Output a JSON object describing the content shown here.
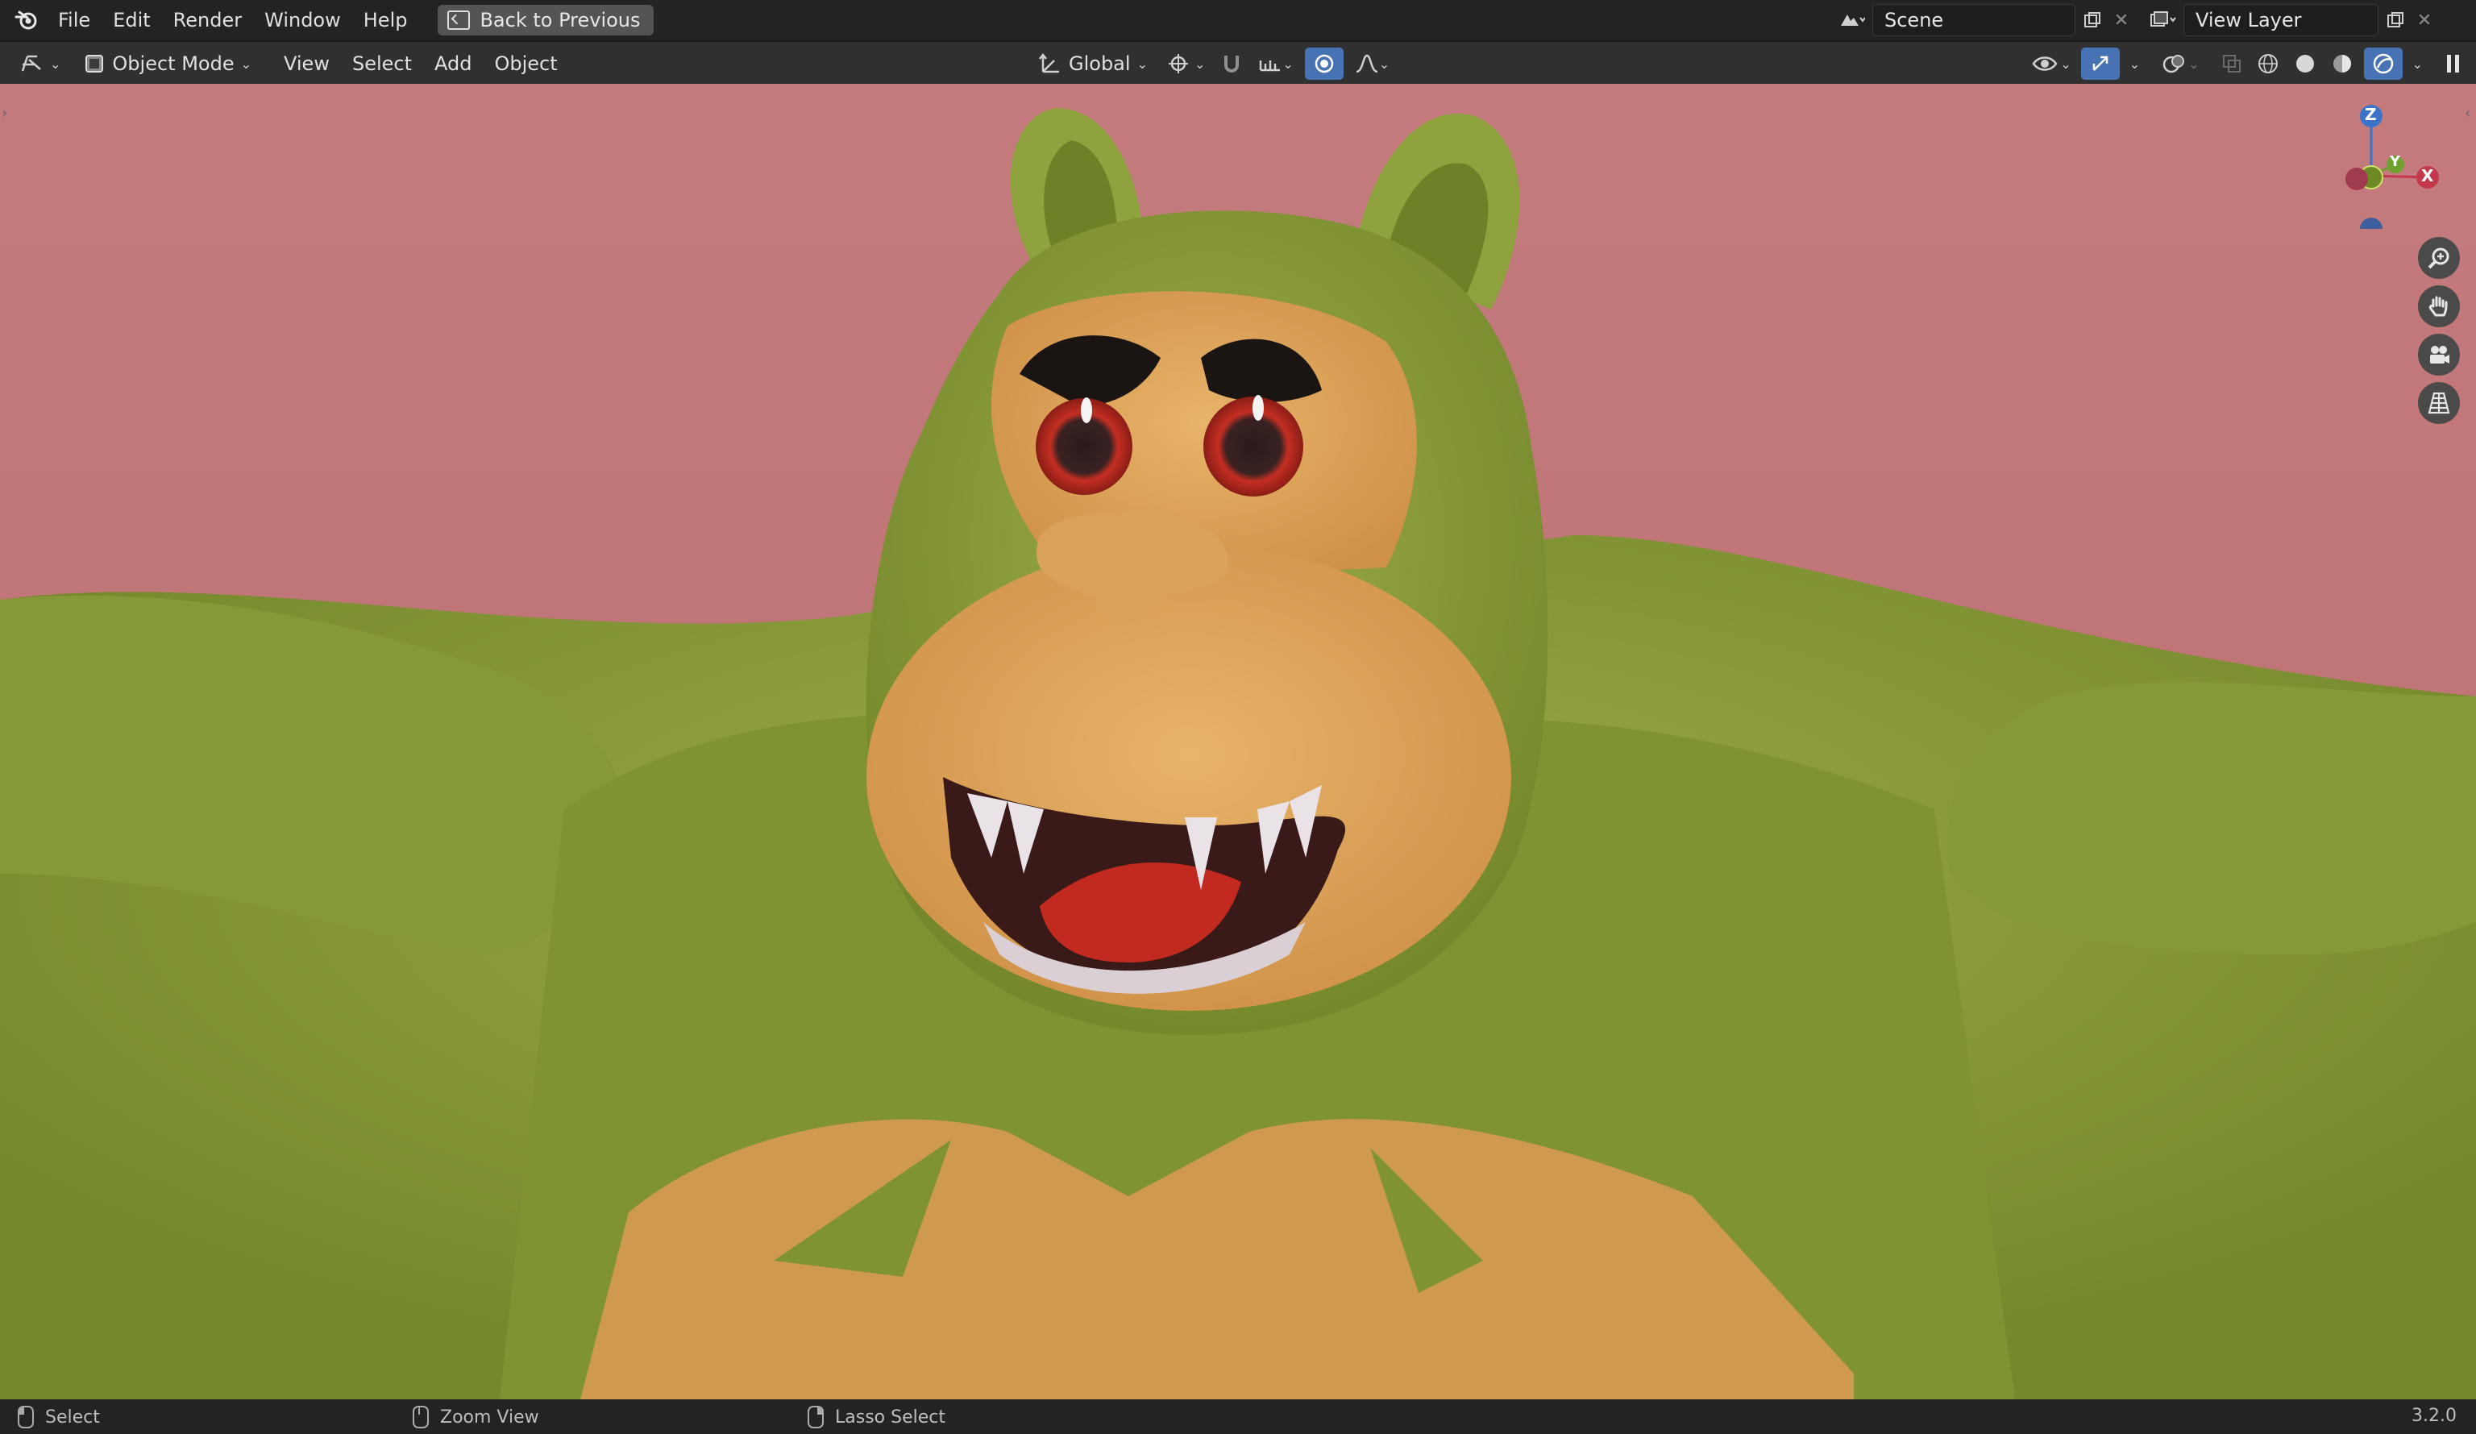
{
  "topbar": {
    "menus": [
      "File",
      "Edit",
      "Render",
      "Window",
      "Help"
    ],
    "back_button": "Back to Previous",
    "scene_name": "Scene",
    "view_layer_name": "View Layer"
  },
  "toolbar": {
    "mode": "Object Mode",
    "menus": [
      "View",
      "Select",
      "Add",
      "Object"
    ],
    "transform_orientation": "Global"
  },
  "gizmo": {
    "z": "Z",
    "y": "Y",
    "x": "X"
  },
  "statusbar": {
    "select": "Select",
    "zoom": "Zoom View",
    "lasso": "Lasso Select",
    "version": "3.2.0"
  },
  "icons": [
    "blender-logo-icon",
    "editor-type-icon",
    "object-mode-icon",
    "transform-orientation-icon",
    "pivot-icon",
    "snap-icon",
    "snap-increment-icon",
    "proportional-edit-icon",
    "falloff-icon",
    "visibility-icon",
    "gizmo-icon",
    "overlay-icon",
    "xray-icon",
    "wireframe-shading-icon",
    "solid-shading-icon",
    "material-shading-icon",
    "rendered-shading-icon",
    "zoom-icon",
    "hand-pan-icon",
    "camera-icon",
    "ortho-grid-icon",
    "mouse-left-icon",
    "mouse-middle-icon",
    "mouse-right-icon"
  ]
}
